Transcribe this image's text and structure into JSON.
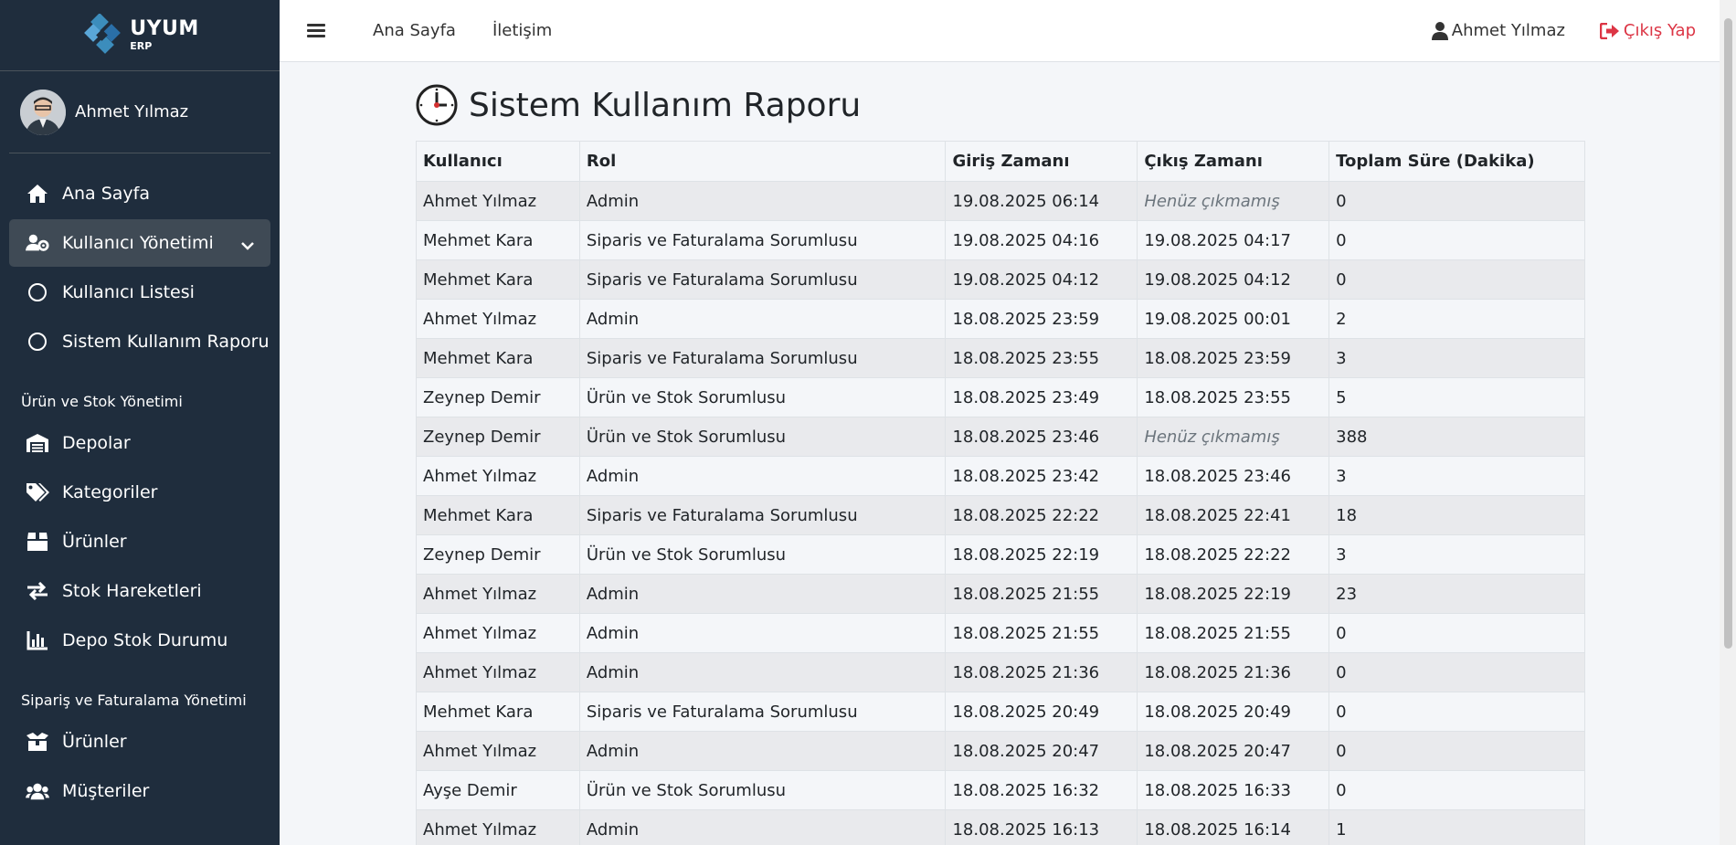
{
  "brand": {
    "name": "UYUM",
    "sub": "ERP"
  },
  "sidebar": {
    "user_name": "Ahmet Yılmaz",
    "items": [
      {
        "label": "Ana Sayfa",
        "icon": "home-icon"
      },
      {
        "label": "Kullanıcı Yönetimi",
        "icon": "users-cog-icon"
      },
      {
        "label": "Kullanıcı Listesi",
        "icon": "circle-icon"
      },
      {
        "label": "Sistem Kullanım Raporu",
        "icon": "circle-icon"
      }
    ],
    "sections": [
      {
        "header": "Ürün ve Stok Yönetimi",
        "items": [
          {
            "label": "Depolar",
            "icon": "warehouse-icon"
          },
          {
            "label": "Kategoriler",
            "icon": "tags-icon"
          },
          {
            "label": "Ürünler",
            "icon": "box-icon"
          },
          {
            "label": "Stok Hareketleri",
            "icon": "exchange-icon"
          },
          {
            "label": "Depo Stok Durumu",
            "icon": "chart-bar-icon"
          }
        ]
      },
      {
        "header": "Sipariş ve Faturalama Yönetimi",
        "items": [
          {
            "label": "Ürünler",
            "icon": "box-open-icon"
          },
          {
            "label": "Müşteriler",
            "icon": "users-icon"
          }
        ]
      }
    ]
  },
  "topbar": {
    "links": [
      "Ana Sayfa",
      "İletişim"
    ],
    "user": "Ahmet Yılmaz",
    "logout": "Çıkış Yap"
  },
  "page": {
    "title": "Sistem Kullanım Raporu",
    "columns": [
      "Kullanıcı",
      "Rol",
      "Giriş Zamanı",
      "Çıkış Zamanı",
      "Toplam Süre (Dakika)"
    ],
    "rows": [
      [
        "Ahmet Yılmaz",
        "Admin",
        "19.08.2025 06:14",
        "Henüz çıkmamış",
        "0"
      ],
      [
        "Mehmet Kara",
        "Siparis ve Faturalama Sorumlusu",
        "19.08.2025 04:16",
        "19.08.2025 04:17",
        "0"
      ],
      [
        "Mehmet Kara",
        "Siparis ve Faturalama Sorumlusu",
        "19.08.2025 04:12",
        "19.08.2025 04:12",
        "0"
      ],
      [
        "Ahmet Yılmaz",
        "Admin",
        "18.08.2025 23:59",
        "19.08.2025 00:01",
        "2"
      ],
      [
        "Mehmet Kara",
        "Siparis ve Faturalama Sorumlusu",
        "18.08.2025 23:55",
        "18.08.2025 23:59",
        "3"
      ],
      [
        "Zeynep Demir",
        "Ürün ve Stok Sorumlusu",
        "18.08.2025 23:49",
        "18.08.2025 23:55",
        "5"
      ],
      [
        "Zeynep Demir",
        "Ürün ve Stok Sorumlusu",
        "18.08.2025 23:46",
        "Henüz çıkmamış",
        "388"
      ],
      [
        "Ahmet Yılmaz",
        "Admin",
        "18.08.2025 23:42",
        "18.08.2025 23:46",
        "3"
      ],
      [
        "Mehmet Kara",
        "Siparis ve Faturalama Sorumlusu",
        "18.08.2025 22:22",
        "18.08.2025 22:41",
        "18"
      ],
      [
        "Zeynep Demir",
        "Ürün ve Stok Sorumlusu",
        "18.08.2025 22:19",
        "18.08.2025 22:22",
        "3"
      ],
      [
        "Ahmet Yılmaz",
        "Admin",
        "18.08.2025 21:55",
        "18.08.2025 22:19",
        "23"
      ],
      [
        "Ahmet Yılmaz",
        "Admin",
        "18.08.2025 21:55",
        "18.08.2025 21:55",
        "0"
      ],
      [
        "Ahmet Yılmaz",
        "Admin",
        "18.08.2025 21:36",
        "18.08.2025 21:36",
        "0"
      ],
      [
        "Mehmet Kara",
        "Siparis ve Faturalama Sorumlusu",
        "18.08.2025 20:49",
        "18.08.2025 20:49",
        "0"
      ],
      [
        "Ahmet Yılmaz",
        "Admin",
        "18.08.2025 20:47",
        "18.08.2025 20:47",
        "0"
      ],
      [
        "Ayşe Demir",
        "Ürün ve Stok Sorumlusu",
        "18.08.2025 16:32",
        "18.08.2025 16:33",
        "0"
      ],
      [
        "Ahmet Yılmaz",
        "Admin",
        "18.08.2025 16:13",
        "18.08.2025 16:14",
        "1"
      ]
    ],
    "not_logged_out_text": "Henüz çıkmamış"
  },
  "colors": {
    "sidebar_bg": "#1f2d3d",
    "logout": "#dc3545",
    "content_bg": "#f4f6f9"
  }
}
